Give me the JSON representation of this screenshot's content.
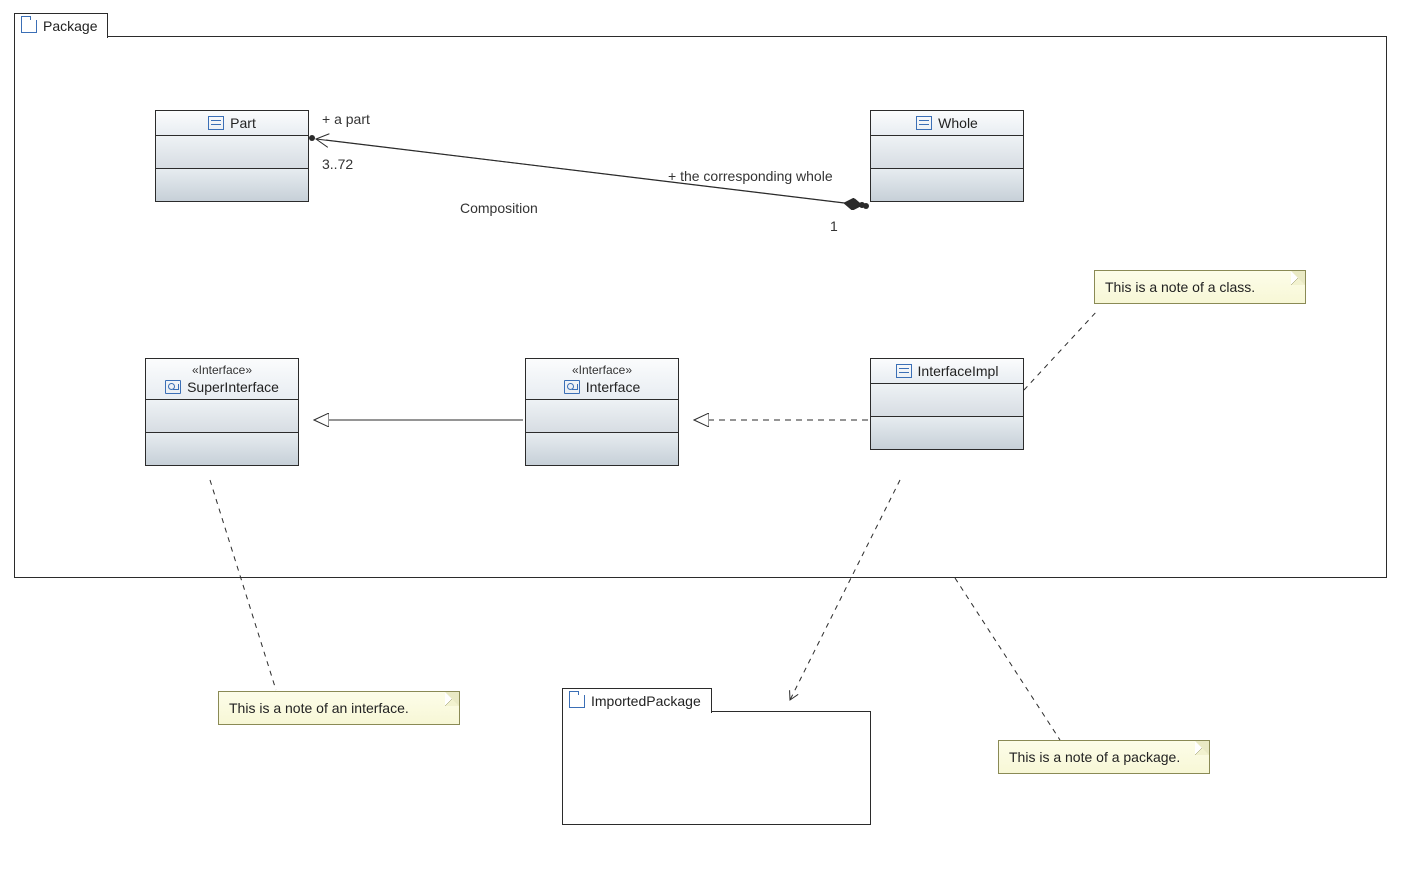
{
  "package": {
    "name": "Package"
  },
  "importedPackage": {
    "name": "ImportedPackage"
  },
  "classes": {
    "part": {
      "name": "Part"
    },
    "whole": {
      "name": "Whole"
    },
    "superInterface": {
      "stereo": "«Interface»",
      "name": "SuperInterface"
    },
    "interface": {
      "stereo": "«Interface»",
      "name": "Interface"
    },
    "interfaceImpl": {
      "name": "InterfaceImpl"
    }
  },
  "assoc": {
    "composition": {
      "label": "Composition",
      "partRole": "+ a part",
      "partMult": "3..72",
      "wholeRole": "+ the corresponding whole",
      "wholeMult": "1"
    }
  },
  "notes": {
    "classNote": "This is a note of a class.",
    "interfaceNote": "This is a note of an interface.",
    "packageNote": "This is a note of a package."
  },
  "colors": {
    "line": "#2b2b2b",
    "accent": "#3b6fb6",
    "noteBg": "#fafad2"
  }
}
